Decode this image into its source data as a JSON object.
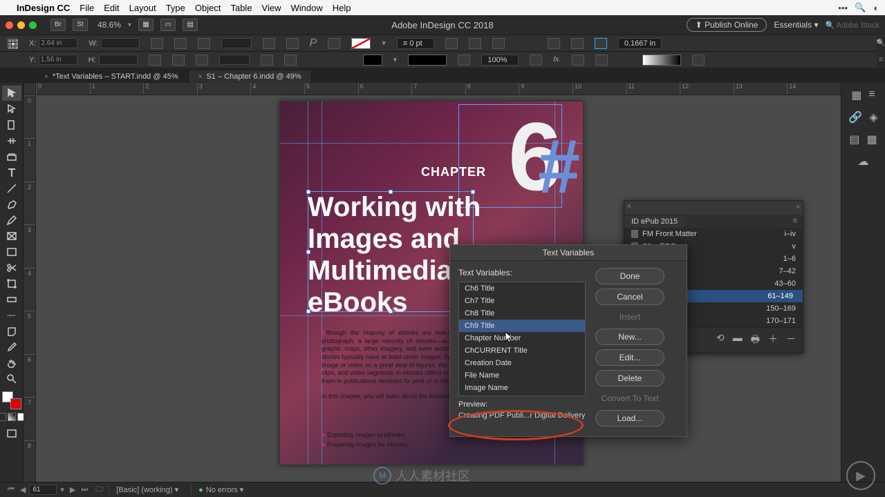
{
  "menubar": {
    "app": "InDesign CC",
    "items": [
      "File",
      "Edit",
      "Layout",
      "Type",
      "Object",
      "Table",
      "View",
      "Window",
      "Help"
    ]
  },
  "appbar": {
    "bridge": "Br",
    "stock_btn": "St",
    "zoom": "48.6%",
    "title": "Adobe InDesign CC 2018",
    "publish": "Publish Online",
    "workspace": "Essentials",
    "stock_search": "Adobe Stock"
  },
  "control": {
    "x_label": "X:",
    "x_value": "2.64 in",
    "y_label": "Y:",
    "y_value": "1.56 in",
    "w_label": "W:",
    "h_label": "H:",
    "stroke_pt": "0 pt",
    "opacity": "100%",
    "fx": "fx.",
    "measure": "0.1667 in"
  },
  "tabs": [
    {
      "label": "*Text Variables – START.indd @ 45%",
      "active": false
    },
    {
      "label": "S1 – Chapter 6.indd @ 49%",
      "active": true
    }
  ],
  "ruler_h": [
    "0",
    "1",
    "2",
    "3",
    "4",
    "5",
    "6",
    "7",
    "8",
    "9",
    "10",
    "11",
    "12",
    "13",
    "14"
  ],
  "ruler_v": [
    "0",
    "1",
    "2",
    "3",
    "4",
    "5",
    "6",
    "7",
    "8"
  ],
  "page": {
    "chapter_label": "CHAPTER",
    "big_number": "6",
    "hash": "#",
    "title": "Working with Images and Multimedia in eBooks",
    "body1": "Although the majority of ebooks are text-only novels or include only the occasional photograph, a large minority of ebooks—across all genres—include illustrations, charts, graphs, maps, other imagery, and even audio and video. Moreover, even novels and short stories typically have at least cover images. Whether your publication merely needs a cover image or relies on a great deal of figures, the process of creating and using graphics, audio clips, and video segments in ebooks differs in several distinct ways from creating and using them in publications destined for print or in other digital formats.",
    "body2": "In this chapter, you will learn about the following:",
    "bullets": [
      "Exporting Images to eBooks",
      "Preparing Images for eBooks"
    ]
  },
  "book_panel": {
    "title": "ID ePub 2015",
    "rows": [
      {
        "name": "FM Front Matter",
        "range": "i–iv"
      },
      {
        "name": "S1 – TOC",
        "range": "v"
      },
      {
        "name": "",
        "range": "1–6"
      },
      {
        "name": "",
        "range": "7–42"
      },
      {
        "name": "",
        "range": "43–60"
      },
      {
        "name": "",
        "range": "61–149",
        "selected": true,
        "current": true
      },
      {
        "name": "",
        "range": "150–169"
      },
      {
        "name": "",
        "range": "170–171"
      }
    ]
  },
  "dialog": {
    "title": "Text Variables",
    "list_label": "Text Variables:",
    "preview_label": "Preview:",
    "preview_value": "Creating PDF Publi...r Digital Delivery",
    "items": [
      "Ch6 Title",
      "Ch7 Title",
      "Ch8 Title",
      "Ch9 Title",
      "Chapter Number",
      "ChCURRENT Title",
      "Creation Date",
      "File Name",
      "Image Name"
    ],
    "selected": "Ch9 Title",
    "buttons": {
      "done": "Done",
      "cancel": "Cancel",
      "insert": "Insert",
      "new": "New...",
      "edit": "Edit...",
      "delete": "Delete",
      "convert": "Convert To Text",
      "load": "Load..."
    }
  },
  "status": {
    "page": "61",
    "master": "[Basic] (working)",
    "errors": "No errors"
  },
  "watermark": "人人素材社区"
}
